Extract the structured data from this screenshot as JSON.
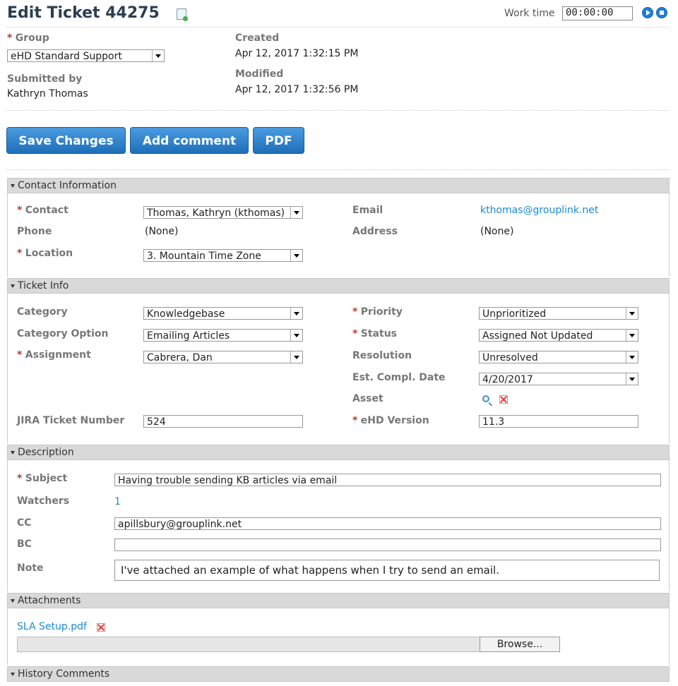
{
  "header": {
    "title": "Edit Ticket 44275",
    "work_time_label": "Work time",
    "work_time_value": "00:00:00"
  },
  "meta": {
    "group_label": "Group",
    "group_value": "eHD Standard Support",
    "submitted_label": "Submitted by",
    "submitted_value": "Kathryn Thomas",
    "created_label": "Created",
    "created_value": "Apr 12, 2017 1:32:15 PM",
    "modified_label": "Modified",
    "modified_value": "Apr 12, 2017 1:32:56 PM"
  },
  "buttons": {
    "save": "Save Changes",
    "comment": "Add comment",
    "pdf": "PDF"
  },
  "contact": {
    "section": "Contact Information",
    "contact_label": "Contact",
    "contact_value": "Thomas, Kathryn (kthomas)",
    "email_label": "Email",
    "email_value": "kthomas@grouplink.net",
    "phone_label": "Phone",
    "phone_value": "(None)",
    "address_label": "Address",
    "address_value": "(None)",
    "location_label": "Location",
    "location_value": "3. Mountain Time Zone"
  },
  "ticket": {
    "section": "Ticket Info",
    "category_label": "Category",
    "category_value": "Knowledgebase",
    "option_label": "Category Option",
    "option_value": "Emailing Articles",
    "assignment_label": "Assignment",
    "assignment_value": "Cabrera, Dan",
    "priority_label": "Priority",
    "priority_value": "Unprioritized",
    "status_label": "Status",
    "status_value": "Assigned Not Updated",
    "resolution_label": "Resolution",
    "resolution_value": "Unresolved",
    "est_label": "Est. Compl. Date",
    "est_value": "4/20/2017",
    "asset_label": "Asset",
    "jira_label": "JIRA Ticket Number",
    "jira_value": "524",
    "version_label": "eHD Version",
    "version_value": "11.3"
  },
  "description": {
    "section": "Description",
    "subject_label": "Subject",
    "subject_value": "Having trouble sending KB articles via email",
    "watchers_label": "Watchers",
    "watchers_value": "1",
    "cc_label": "CC",
    "cc_value": "apillsbury@grouplink.net",
    "bc_label": "BC",
    "bc_value": "",
    "note_label": "Note",
    "note_value": "I've attached an example of what happens when I try to send an email."
  },
  "attachments": {
    "section": "Attachments",
    "file_name": "SLA Setup.pdf",
    "browse_label": "Browse..."
  },
  "history": {
    "section": "History Comments"
  },
  "colors": {
    "button_blue": "#1e6fb8",
    "link_blue": "#1d8ad0",
    "required_red": "#c0392b"
  }
}
